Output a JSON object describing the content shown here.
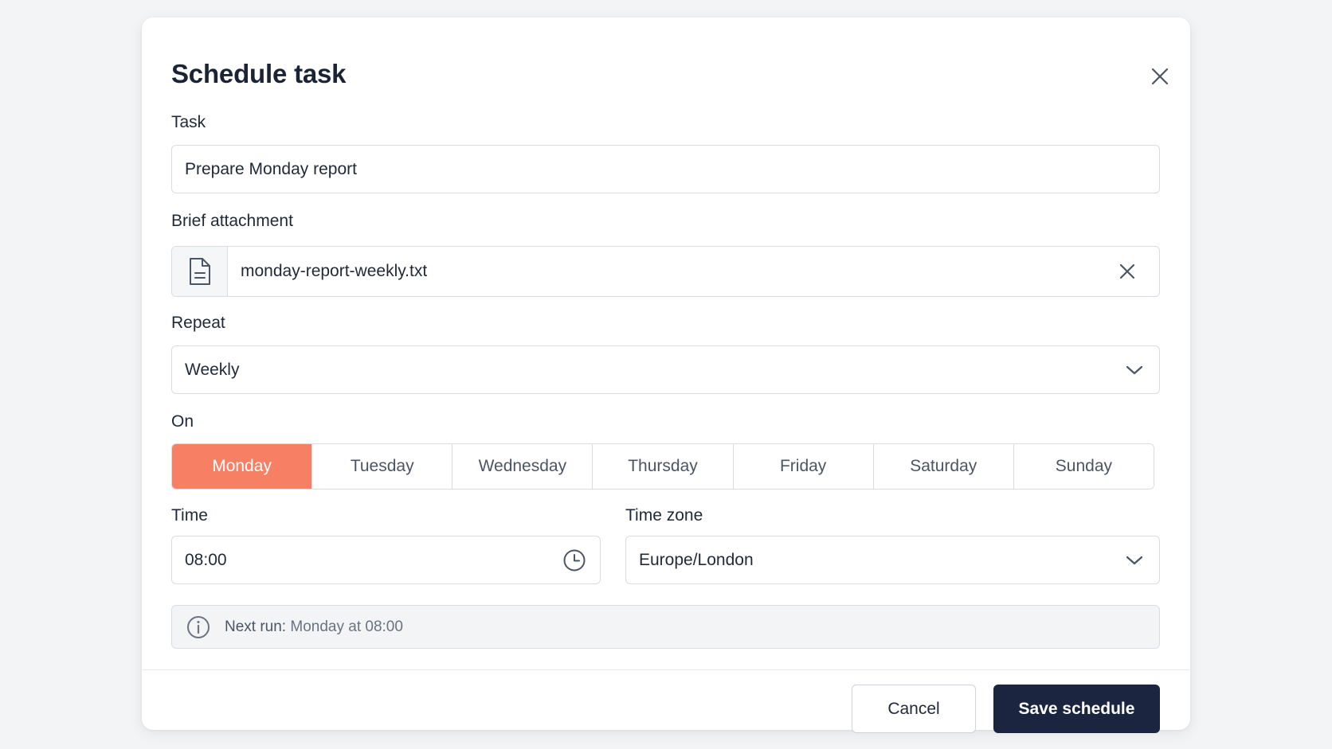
{
  "dialog": {
    "title": "Schedule task"
  },
  "task": {
    "label": "Task",
    "value": "Prepare Monday report"
  },
  "attachment": {
    "label": "Brief attachment",
    "filename": "monday-report-weekly.txt"
  },
  "repeat": {
    "label": "Repeat",
    "value": "Weekly"
  },
  "on": {
    "label": "On",
    "days": [
      "Monday",
      "Tuesday",
      "Wednesday",
      "Thursday",
      "Friday",
      "Saturday",
      "Sunday"
    ],
    "selected": "Monday"
  },
  "time": {
    "label": "Time",
    "value": "08:00"
  },
  "timezone": {
    "label": "Time zone",
    "value": "Europe/London"
  },
  "next_run": {
    "prefix": "Next run:",
    "value": "Monday at 08:00"
  },
  "footer": {
    "cancel_label": "Cancel",
    "save_label": "Save schedule"
  },
  "colors": {
    "accent": "#f67f64",
    "primary_button": "#1b2540"
  },
  "icons": {
    "close": "close-icon",
    "file": "file-icon",
    "remove": "remove-attachment-icon",
    "chevron": "chevron-down-icon",
    "clock": "clock-icon",
    "info": "info-icon"
  }
}
